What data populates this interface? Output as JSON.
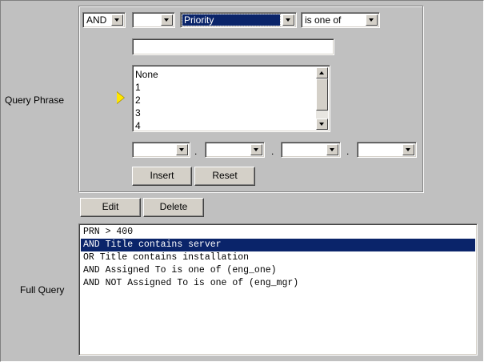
{
  "labels": {
    "query_phrase": "Query Phrase",
    "full_query": "Full Query"
  },
  "phrase": {
    "conjunction": "AND",
    "negation": "",
    "field": "Priority",
    "operator": "is one of",
    "value_text": "",
    "value_list": [
      "None",
      "1",
      "2",
      "3",
      "4"
    ],
    "range_selects": [
      "",
      "",
      "",
      ""
    ],
    "range_separator": ".",
    "insert_label": "Insert",
    "reset_label": "Reset"
  },
  "query_actions": {
    "edit_label": "Edit",
    "delete_label": "Delete"
  },
  "full_query": {
    "lines": [
      "PRN > 400",
      "AND Title contains server",
      "OR Title contains installation",
      "AND Assigned To is one of (eng_one)",
      "AND NOT Assigned To is one of (eng_mgr)"
    ],
    "selected_index": 1
  },
  "colors": {
    "background": "#c0c0c0",
    "selection": "#0a246a",
    "current_marker": "#ffe600"
  },
  "icons": {
    "current_phrase_marker": "triangle-right-icon",
    "dropdown": "chevron-down-icon"
  }
}
